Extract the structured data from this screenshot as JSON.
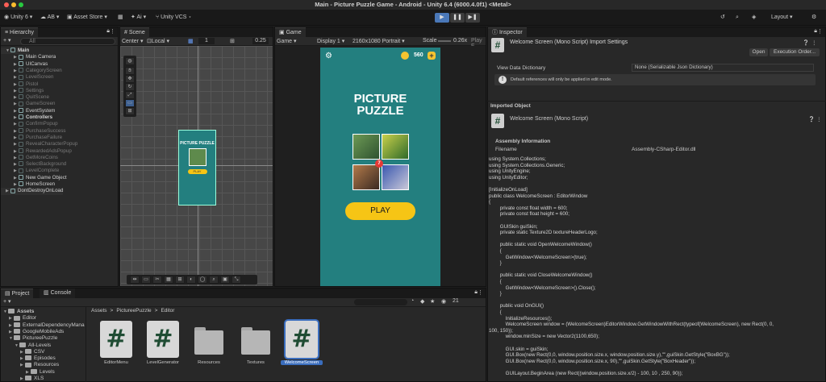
{
  "window": {
    "title": "Main - Picture Puzzle Game - Android - Unity 6.4 (6000.4.0f1) <Metal>"
  },
  "toolbar": {
    "account": "Unity 6",
    "ai_dropdown": "AB",
    "asset_store": "Asset Store",
    "ai_button": "Ai",
    "vcs": "Unity VCS",
    "layout": "Layout"
  },
  "hierarchy": {
    "tab": "Hierarchy",
    "search_placeholder": "All",
    "items": [
      {
        "label": "Main",
        "level": 0,
        "expanded": true,
        "active": true,
        "bold": true
      },
      {
        "label": "Main Camera",
        "level": 1,
        "active": true
      },
      {
        "label": "UICanvas",
        "level": 1,
        "active": true
      },
      {
        "label": "CategoryScreen",
        "level": 1,
        "active": false
      },
      {
        "label": "LevelScreen",
        "level": 1,
        "active": false
      },
      {
        "label": "Pistol",
        "level": 1,
        "active": false
      },
      {
        "label": "Settings",
        "level": 1,
        "active": false
      },
      {
        "label": "QuitScene",
        "level": 1,
        "active": false
      },
      {
        "label": "GameScreen",
        "level": 1,
        "active": false
      },
      {
        "label": "EventSystem",
        "level": 1,
        "active": true
      },
      {
        "label": "Controllers",
        "level": 1,
        "active": true,
        "bold": true
      },
      {
        "label": "ConfirmPopup",
        "level": 1,
        "active": false
      },
      {
        "label": "PurchaseSuccess",
        "level": 1,
        "active": false
      },
      {
        "label": "PurchaseFailure",
        "level": 1,
        "active": false
      },
      {
        "label": "RevealCharacterPopup",
        "level": 1,
        "active": false
      },
      {
        "label": "RewardedAdsPopup",
        "level": 1,
        "active": false
      },
      {
        "label": "GetMoreCoins",
        "level": 1,
        "active": false
      },
      {
        "label": "SelectBackground",
        "level": 1,
        "active": false
      },
      {
        "label": "LevelComplete",
        "level": 1,
        "active": false
      },
      {
        "label": "New Game Object",
        "level": 1,
        "active": true
      },
      {
        "label": "HomeScreen",
        "level": 1,
        "active": true
      },
      {
        "label": "DontDestroyOnLoad",
        "level": 0,
        "expanded": false,
        "active": true
      }
    ]
  },
  "scene": {
    "tab": "Scene",
    "pivot": "Center",
    "space": "Local",
    "grid_value": "1",
    "snap_value": "0.25",
    "mini_title": "PICTURE PUZZLE",
    "mini_play": "PLAY"
  },
  "game": {
    "tab": "Game",
    "mode": "Game",
    "display": "Display 1",
    "resolution": "2160x1080 Portrait",
    "scale_label": "Scale",
    "scale_value": "0.26x",
    "play_focused": "Play F",
    "coins": "560",
    "title_line1": "PICTURE",
    "title_line2": "PUZZLE",
    "badge": "7",
    "play_button": "PLAY"
  },
  "project": {
    "tabs": [
      "Project",
      "Console"
    ],
    "breadcrumb": [
      "Assets",
      "PictureePuzzle",
      "Editor"
    ],
    "breadcrumb_sep": ">",
    "count": "21",
    "tree": [
      {
        "label": "Assets",
        "level": 0,
        "bold": true
      },
      {
        "label": "Editor",
        "level": 1
      },
      {
        "label": "ExternalDependencyMana",
        "level": 1
      },
      {
        "label": "GoogleMobileAds",
        "level": 1
      },
      {
        "label": "PictureePuzzle",
        "level": 1
      },
      {
        "label": "All-Levels",
        "level": 2
      },
      {
        "label": "CSV",
        "level": 3
      },
      {
        "label": "Episodes",
        "level": 3
      },
      {
        "label": "Resources",
        "level": 3
      },
      {
        "label": "Levels",
        "level": 4
      },
      {
        "label": "XLS",
        "level": 3
      }
    ],
    "assets": [
      {
        "label": "EditorMenu",
        "kind": "script"
      },
      {
        "label": "LevelGenerator",
        "kind": "script"
      },
      {
        "label": "Resources",
        "kind": "folder"
      },
      {
        "label": "Textures",
        "kind": "folder"
      },
      {
        "label": "WelcomeScreen",
        "kind": "script",
        "selected": true
      }
    ]
  },
  "inspector": {
    "tab": "Inspector",
    "header": "Welcome Screen (Mono Script) Import Settings",
    "open_button": "Open",
    "exec_order_button": "Execution Order...",
    "view_data_label": "View Data Dictionary",
    "view_data_value": "None (Serializable Json Dictionary)",
    "notice": "Default references will only be applied in edit mode.",
    "imported_object": "Imported Object",
    "object_title": "Welcome Screen (Mono Script)",
    "assembly_info": "Assembly Information",
    "filename_label": "Filename",
    "filename_value": "Assembly-CSharp-Editor.dll",
    "code": [
      "using System.Collections;",
      "using System.Collections.Generic;",
      "using UnityEngine;",
      "using UnityEditor;",
      "",
      "[InitializeOnLoad]",
      "public class WelcomeScreen : EditorWindow",
      "{",
      "        private const float width = 600;",
      "        private const float height = 600;",
      "",
      "        GUISkin guiSkin;",
      "        private static Texture2D textureHeaderLogo;",
      "",
      "        public static void OpenWelcomeWindow()",
      "        {",
      "            GetWindow<WelcomeScreen>(true);",
      "        }",
      "",
      "        public static void CloseWelcomeWindow()",
      "        {",
      "            GetWindow<WelcomeScreen>().Close();",
      "        }",
      "",
      "        public void OnGUI()",
      "        {",
      "            InitializeResources();",
      "            WelcomeScreen window = (WelcomeScreen)EditorWindow.GetWindowWithRect(typeof(WelcomeScreen), new Rect(0, 0,",
      "100, 150));",
      "            window.minSize = new Vector2(1100,650);",
      "",
      "            GUI.skin = guiSkin;",
      "            GUI.Box(new Rect(0,0, window.position.size.x, window.position.size.y),\"\",guiSkin.GetStyle(\"BoxBG\"));",
      "            GUI.Box(new Rect(0,0, window.position.size.x, 90),\"\",guiSkin.GetStyle(\"BoxHeader\"));",
      "",
      "            GUILayout.BeginArea (new Rect((window.position.size.x/2) - 100, 10 , 250, 90));"
    ]
  }
}
